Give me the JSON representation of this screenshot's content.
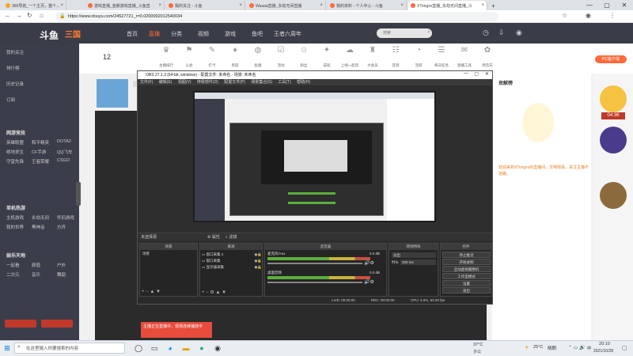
{
  "browser": {
    "tabs": [
      {
        "label": "360导航_一个主页，整个世界",
        "color": "#f5a623"
      },
      {
        "label": "游戏直播_金鹏游戏直播_斗鱼直",
        "color": "#ff6a3d"
      },
      {
        "label": "我的关注 - 斗鱼",
        "color": "#ff6a3d"
      },
      {
        "label": "Waaaa直播_永劫无间直播",
        "color": "#ff6a3d"
      },
      {
        "label": "我的资料 - 个人中心 - 斗鱼",
        "color": "#ff6a3d"
      },
      {
        "label": "XTongxx直播_永劫无间直播_斗",
        "color": "#ff6a3d"
      }
    ],
    "url": "https://www.douyu.com/24527721_r=0.0200092012540034",
    "controls": [
      "—",
      "▢",
      "✕"
    ]
  },
  "douyu": {
    "logo": "斗鱼",
    "logo2": "三国",
    "nav": [
      "首页",
      "直播",
      "分类",
      "视频",
      "游戏",
      "鱼吧",
      "王者六周年"
    ],
    "search_placeholder": "搜索",
    "sidebar_top": [
      "我的关注",
      "排行榜",
      "历史记录",
      "订阅"
    ],
    "sidebar_sections": [
      {
        "title": "网游竞技",
        "items": [
          "英雄联盟",
          "和平精英",
          "DOTA2",
          "绝地求生",
          "CF手游",
          "QQ飞车",
          "守望先锋",
          "王者荣耀",
          "CSGO"
        ]
      },
      {
        "title": "单机热游",
        "items": [
          "主机游戏",
          "永劫无间",
          "怀旧游戏",
          "我的世界",
          "黑神话",
          "方舟"
        ]
      },
      {
        "title": "娱乐天地",
        "items": [
          "一起看",
          "颜值",
          "户外",
          "二次元",
          "音乐",
          "舞蹈"
        ]
      }
    ],
    "quick_icons": [
      "主播排行",
      "公会",
      "打卡",
      "贵族",
      "鱼塘",
      "活动",
      "粉丝",
      "成就",
      "上线一起玩",
      "大会员",
      "签到",
      "活跃",
      "每日任务",
      "直播工具",
      "周年庆"
    ],
    "level_num": "12",
    "pc_badge": "PC客户端",
    "right_notice": "欢迎来到XTongxx的直播间，文明观看，关注主播不迷路。",
    "right_rank": "贡献榜",
    "timer": "04:36",
    "live_banner": "主播正在直播中，现场连续播放中",
    "video_bar": [
      "赠送礼物",
      "充值"
    ]
  },
  "obs": {
    "title": "OBS 27.1.3 (64-bit, windows) - 配置文件: 未命名 - 场景: 未命名",
    "menu": [
      "文件(F)",
      "编辑(E)",
      "视图(V)",
      "停靠部件(D)",
      "配置文件(P)",
      "场景集合(S)",
      "工具(T)",
      "帮助(H)"
    ],
    "sel_label": "未选择源",
    "props_btn": "属性",
    "filter_btn": "滤镜",
    "panels": {
      "scenes": {
        "title": "场景",
        "items": [
          "场景"
        ]
      },
      "sources": {
        "title": "来源",
        "items": [
          "窗口采集 2",
          "窗口采集",
          "显示器采集"
        ]
      },
      "mixer": {
        "title": "混音器",
        "tracks": [
          {
            "name": "麦克风/Aux",
            "db": "0.0 dB"
          },
          {
            "name": "桌面音频",
            "db": "0.0 dB"
          }
        ]
      },
      "transitions": {
        "title": "转场特效",
        "type": "淡出",
        "duration_label": "时长",
        "duration": "300 ms"
      },
      "controls": {
        "title": "控件",
        "buttons": [
          "停止推流",
          "开始录制",
          "启动虚拟摄像机",
          "工作室模式",
          "设置",
          "退出"
        ]
      }
    },
    "status": {
      "live": "LIVE: 00:00:00",
      "rec": "REC: 00:00:00",
      "cpu": "CPU: 3.0%, 60.00 fps"
    }
  },
  "taskbar": {
    "search_placeholder": "在这里输入你要搜索的内容",
    "weather": "37°C",
    "weather2": "多云",
    "temp": "25°C",
    "weather3": "晴朗",
    "time": "20:10",
    "date": "2021/10/28",
    "lang": "中"
  }
}
